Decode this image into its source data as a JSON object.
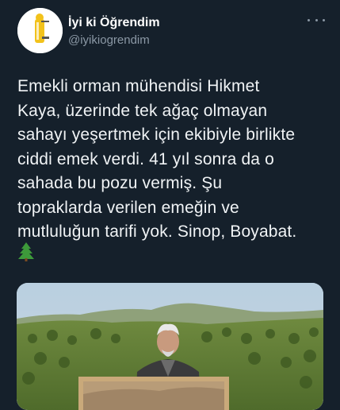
{
  "tweet": {
    "author": {
      "display_name": "İyi ki Öğrendim",
      "handle": "@iyikiogrendim",
      "avatar_icon": "light-bulb-icon"
    },
    "more_icon": "more-options-icon",
    "text_lines": [
      "Emekli orman mühendisi Hikmet",
      "Kaya, üzerinde tek ağaç olmayan",
      "sahayı yeşertmek için ekibiyle birlikte",
      "ciddi emek verdi. 41 yıl sonra da o",
      "sahada bu pozu vermiş. Şu",
      "topraklarda verilen emeğin ve",
      "mutluluğun tarifi yok. Sinop, Boyabat."
    ],
    "emoji": "evergreen-tree-icon",
    "media": {
      "description_icon": "photo-icon"
    }
  },
  "colors": {
    "background": "#15202b",
    "text": "#f0f3f5",
    "secondary": "#8b98a5"
  }
}
